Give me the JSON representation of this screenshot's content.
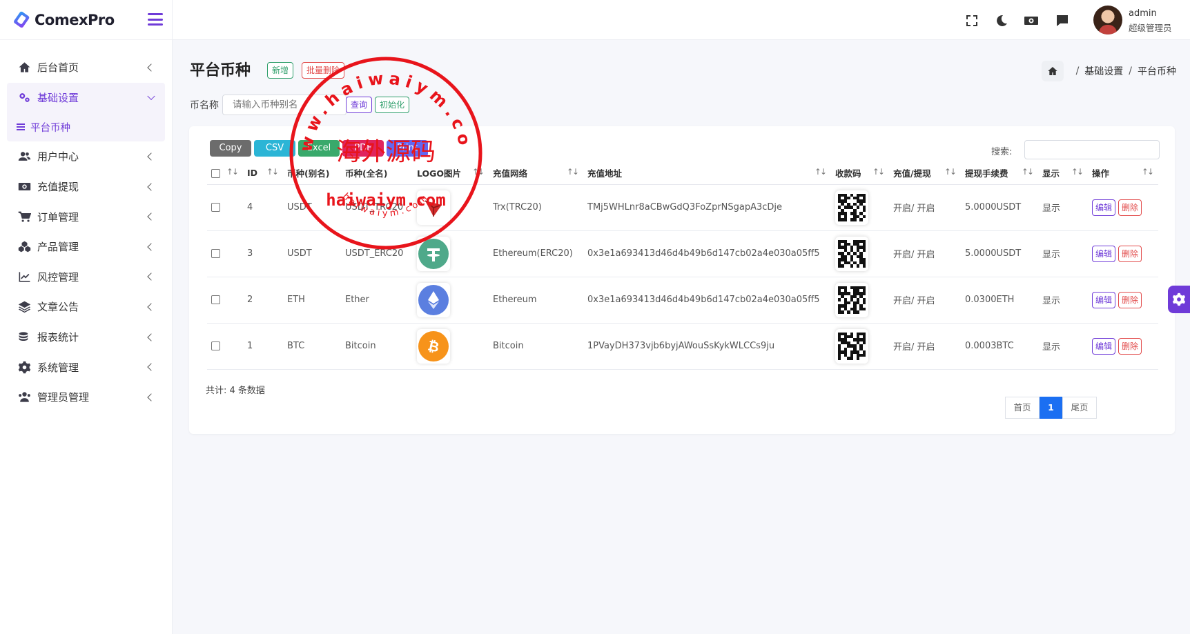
{
  "brand": {
    "name": "ComexPro"
  },
  "sidebar": {
    "items": [
      {
        "label": "后台首页",
        "icon": "home-icon"
      },
      {
        "label": "基础设置",
        "icon": "gears-icon",
        "active": true
      },
      {
        "label": "用户中心",
        "icon": "users-icon"
      },
      {
        "label": "充值提现",
        "icon": "money-icon"
      },
      {
        "label": "订单管理",
        "icon": "cart-icon"
      },
      {
        "label": "产品管理",
        "icon": "cubes-icon"
      },
      {
        "label": "风控管理",
        "icon": "chart-line-icon"
      },
      {
        "label": "文章公告",
        "icon": "layers-icon"
      },
      {
        "label": "报表统计",
        "icon": "coins-icon"
      },
      {
        "label": "系统管理",
        "icon": "gear-icon"
      },
      {
        "label": "管理员管理",
        "icon": "user-group-icon"
      }
    ],
    "sub_item": "平台币种"
  },
  "header": {
    "user_name": "admin",
    "user_role": "超级管理员"
  },
  "page": {
    "title": "平台币种",
    "add_label": "新增",
    "batch_delete_label": "批量删除",
    "breadcrumb": [
      "基础设置",
      "平台币种"
    ],
    "filter_label": "币名称",
    "filter_placeholder": "请输入币种别名",
    "query_label": "查询",
    "reset_label": "初始化"
  },
  "toolbar": {
    "export_buttons": [
      {
        "label": "Copy",
        "color": "#6c6c6c"
      },
      {
        "label": "CSV",
        "color": "#2bb5d6"
      },
      {
        "label": "Excel",
        "color": "#39a96b"
      },
      {
        "label": "PDF",
        "color": "#e0245e"
      },
      {
        "label": "Print",
        "color": "#6366f1"
      }
    ],
    "search_label": "搜索:"
  },
  "table": {
    "headers": [
      "ID",
      "币种(别名)",
      "币种(全名)",
      "LOGO图片",
      "充值网络",
      "充值地址",
      "收款码",
      "充值/提现",
      "提现手续费",
      "显示",
      "操作"
    ],
    "rows": [
      {
        "id": "4",
        "alias": "USDT",
        "fullname": "USDT_TRC20",
        "logo": "tron",
        "network": "Trx(TRC20)",
        "address": "TMj5WHLnr8aCBwGdQ3FoZprNSgapA3cDje",
        "deposit_withdraw": "开启/ 开启",
        "fee": "5.0000USDT",
        "display": "显示"
      },
      {
        "id": "3",
        "alias": "USDT",
        "fullname": "USDT_ERC20",
        "logo": "tether",
        "network": "Ethereum(ERC20)",
        "address": "0x3e1a693413d46d4b49b6d147cb02a4e030a05ff5",
        "deposit_withdraw": "开启/ 开启",
        "fee": "5.0000USDT",
        "display": "显示"
      },
      {
        "id": "2",
        "alias": "ETH",
        "fullname": "Ether",
        "logo": "ethereum",
        "network": "Ethereum",
        "address": "0x3e1a693413d46d4b49b6d147cb02a4e030a05ff5",
        "deposit_withdraw": "开启/ 开启",
        "fee": "0.0300ETH",
        "display": "显示"
      },
      {
        "id": "1",
        "alias": "BTC",
        "fullname": "Bitcoin",
        "logo": "bitcoin",
        "network": "Bitcoin",
        "address": "1PVayDH373vjb6byjAWouSsKykWLCCs9ju",
        "deposit_withdraw": "开启/ 开启",
        "fee": "0.0003BTC",
        "display": "显示"
      }
    ],
    "edit_label": "编辑",
    "delete_label": "删除"
  },
  "footer": {
    "total_text": "共计: 4 条数据",
    "first_label": "首页",
    "current_page": "1",
    "last_label": "尾页"
  },
  "watermark": {
    "url_text": "www.haiwaiym.com",
    "name_text": "海外源码",
    "center_text": "haiwaiym.com",
    "bottom_text": "haiwaiym.com"
  },
  "colors": {
    "accent": "#6f3bd8",
    "page_current": "#1b6ff2",
    "danger": "#e24a4a",
    "success": "#2e9e6a"
  }
}
